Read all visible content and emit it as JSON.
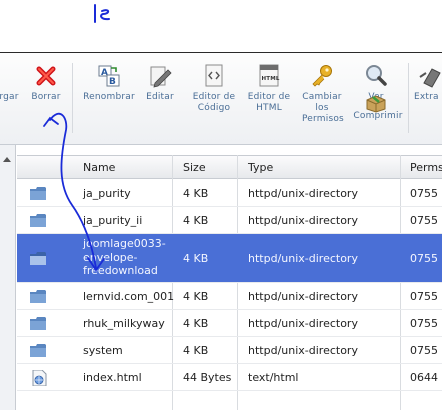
{
  "toolbar": {
    "buttons": [
      {
        "label": "rgar",
        "icon": "upload-icon"
      },
      {
        "label": "Borrar",
        "icon": "delete-x-icon"
      },
      {
        "label": "Renombrar",
        "icon": "rename-ab-icon"
      },
      {
        "label": "Editar",
        "icon": "edit-pencil-icon"
      },
      {
        "label": "Editor de Código",
        "icon": "code-editor-icon"
      },
      {
        "label": "Editor de HTML",
        "icon": "html-editor-icon"
      },
      {
        "label": "Cambiar los Permisos",
        "icon": "permissions-key-icon"
      },
      {
        "label": "Ver",
        "icon": "magnifier-icon"
      },
      {
        "label": "Comprimir",
        "icon": "compress-box-icon"
      },
      {
        "label": "Extra",
        "icon": "extract-icon"
      }
    ]
  },
  "table": {
    "headers": [
      "Name",
      "Size",
      "Type",
      "Perms"
    ],
    "rows": [
      {
        "name": "ja_purity",
        "size": "4 KB",
        "type": "httpd/unix-directory",
        "perms": "0755",
        "icon": "folder-icon",
        "selected": false
      },
      {
        "name": "ja_purity_ii",
        "size": "4 KB",
        "type": "httpd/unix-directory",
        "perms": "0755",
        "icon": "folder-icon",
        "selected": false
      },
      {
        "name": "joomlage0033-envelope-freedownload",
        "name_lines": [
          "joomlage0033-",
          "envelope-",
          "freedownload"
        ],
        "size": "4 KB",
        "type": "httpd/unix-directory",
        "perms": "0755",
        "icon": "folder-icon",
        "selected": true
      },
      {
        "name": "lernvid.com_001",
        "size": "4 KB",
        "type": "httpd/unix-directory",
        "perms": "0755",
        "icon": "folder-icon",
        "selected": false
      },
      {
        "name": "rhuk_milkyway",
        "size": "4 KB",
        "type": "httpd/unix-directory",
        "perms": "0755",
        "icon": "folder-icon",
        "selected": false
      },
      {
        "name": "system",
        "size": "4 KB",
        "type": "httpd/unix-directory",
        "perms": "0755",
        "icon": "folder-icon",
        "selected": false
      },
      {
        "name": "index.html",
        "size": "44 Bytes",
        "type": "text/html",
        "perms": "0644",
        "icon": "html-file-icon",
        "selected": false
      }
    ]
  },
  "colors": {
    "selection": "#4a6fd6",
    "annotation_ink": "#1a2bd8",
    "toolbar_text": "#4a6e96"
  }
}
